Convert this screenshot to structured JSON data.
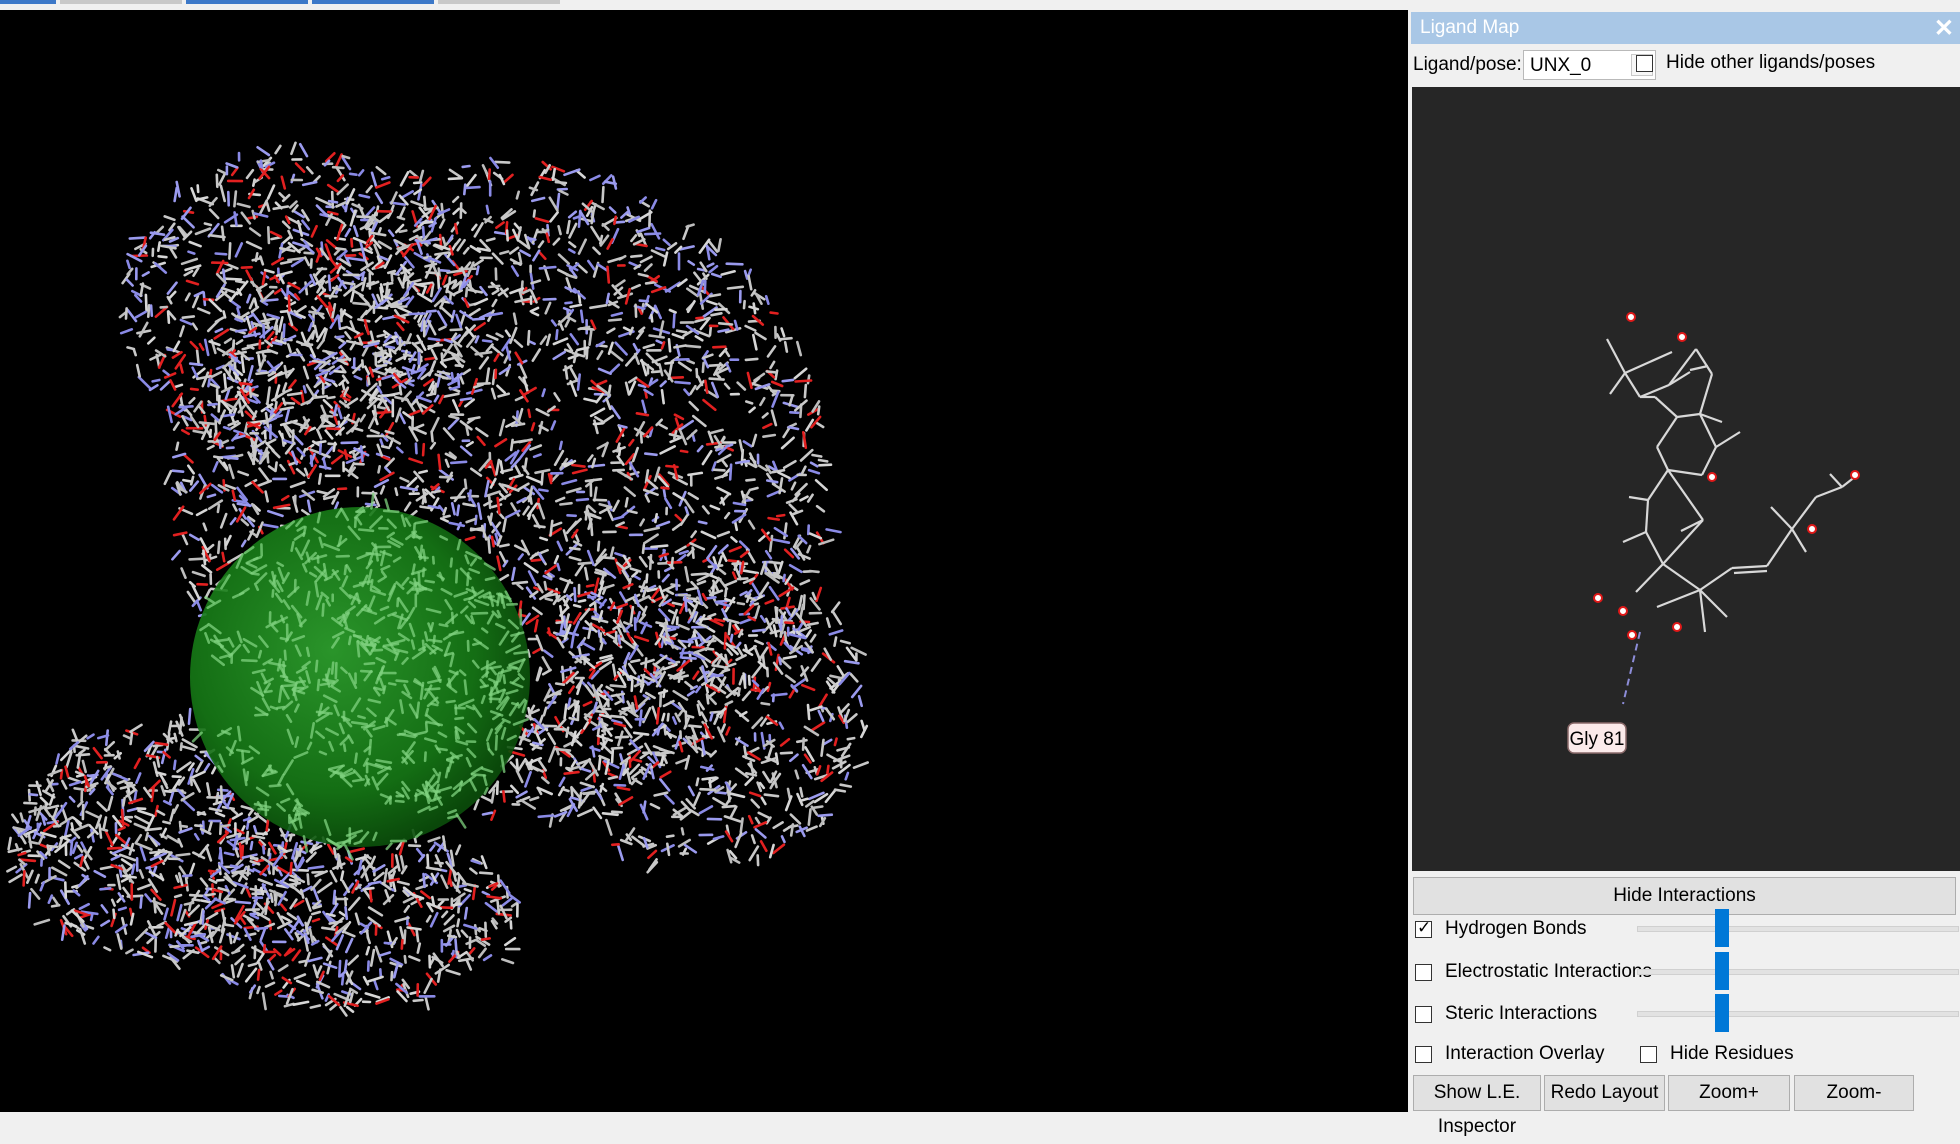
{
  "top_tabs": [
    "",
    "",
    "",
    "",
    ""
  ],
  "ligand_map": {
    "title": "Ligand Map",
    "close_glyph": "✕",
    "ligand_pose_label": "Ligand/pose:",
    "ligand_pose_value": "UNX_0",
    "hide_other_label": "Hide other ligands/poses",
    "residue_label": "Gly 81",
    "hide_interactions_label": "Hide Interactions",
    "options": [
      {
        "label": "Hydrogen Bonds",
        "checked": true,
        "slider": 0.27
      },
      {
        "label": "Electrostatic Interactions",
        "checked": false,
        "slider": 0.27
      },
      {
        "label": "Steric Interactions",
        "checked": false,
        "slider": 0.27
      }
    ],
    "interaction_overlay_label": "Interaction Overlay",
    "hide_residues_label": "Hide Residues",
    "buttons": {
      "show_le_inspector": "Show L.E. Inspector",
      "redo_layout": "Redo Layout",
      "zoom_in": "Zoom+",
      "zoom_out": "Zoom-"
    }
  },
  "colors": {
    "title_bar": "#a9c7e6",
    "slider_thumb": "#0078d7",
    "viewport_bg": "#000000",
    "map_bg": "#262626",
    "sphere": "#1e8a1e"
  }
}
